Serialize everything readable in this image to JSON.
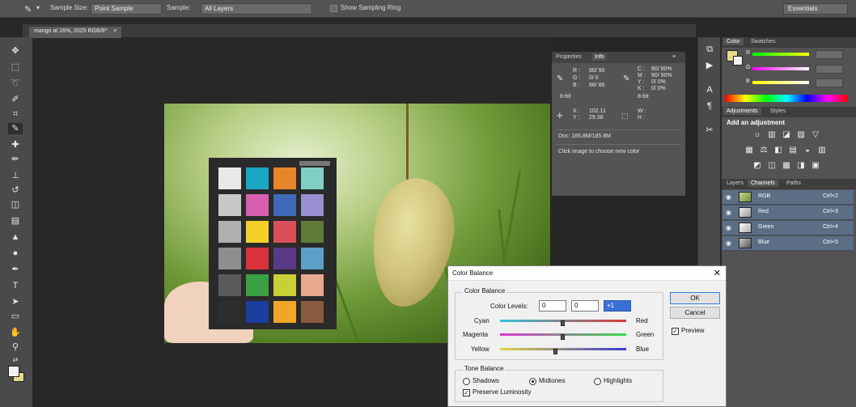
{
  "options_bar": {
    "sample_size_label": "Sample Size:",
    "sample_size_value": "Point Sample",
    "sample_label": "Sample:",
    "sample_value": "All Layers",
    "show_ring_label": "Show Sampling Ring",
    "workspace": "Essentials"
  },
  "document": {
    "tab_title": "mango at 16%, 2025 RGB/8*"
  },
  "info_panel": {
    "tabs": [
      "Properties",
      "Info"
    ],
    "rgb_rows": [
      "R :",
      "G :",
      "B :"
    ],
    "rgb_vals": [
      "90/ 90",
      "0/ 0",
      "86/ 86"
    ],
    "cmyk_rows": [
      "C :",
      "M :",
      "Y :",
      "K :"
    ],
    "cmyk_vals": [
      "80/ 80%",
      "90/ 90%",
      "0/ 0%",
      "0/ 0%"
    ],
    "bit_left": "8-bit",
    "bit_right": "8-bit",
    "xy_rows": [
      "X :",
      "Y :"
    ],
    "xy_vals": [
      "102.11",
      "29.38"
    ],
    "wh_rows": [
      "W :",
      "H :"
    ],
    "doc_size": "Doc: 185.8M/185.8M",
    "hint": "Click image to choose new color"
  },
  "color_panel": {
    "tabs": [
      "Color",
      "Swatches"
    ],
    "channel_labels": [
      "R",
      "G",
      "B"
    ]
  },
  "adjustments_panel": {
    "tabs": [
      "Adjustments",
      "Styles"
    ],
    "heading": "Add an adjustment",
    "icon_rows": [
      [
        "☼",
        "▥",
        "◪",
        "▨",
        "▽"
      ],
      [
        "▦",
        "⚖",
        "◧",
        "▤",
        "◒",
        "▥"
      ],
      [
        "◩",
        "◫",
        "▩",
        "◨",
        "▣"
      ]
    ]
  },
  "channels_panel": {
    "tabs": [
      "Layers",
      "Channels",
      "Paths"
    ],
    "rows": [
      {
        "name": "RGB",
        "shortcut": "Ctrl+2"
      },
      {
        "name": "Red",
        "shortcut": "Ctrl+3"
      },
      {
        "name": "Green",
        "shortcut": "Ctrl+4"
      },
      {
        "name": "Blue",
        "shortcut": "Ctrl+5"
      }
    ]
  },
  "dialog": {
    "title": "Color Balance",
    "close": "✕",
    "color_balance_group": "Color Balance",
    "color_levels_label": "Color Levels:",
    "levels": [
      "0",
      "0",
      "+1"
    ],
    "sliders": [
      {
        "left": "Cyan",
        "right": "Red",
        "fraction": 0.5
      },
      {
        "left": "Magenta",
        "right": "Green",
        "fraction": 0.5
      },
      {
        "left": "Yellow",
        "right": "Blue",
        "fraction": 0.44
      }
    ],
    "tone_balance_group": "Tone Balance",
    "tones": [
      "Shadows",
      "Midtones",
      "Highlights"
    ],
    "selected_tone": "Midtones",
    "preserve_luminosity": "Preserve Luminosity",
    "ok": "OK",
    "cancel": "Cancel",
    "preview": "Preview"
  },
  "colors": {
    "foreground": "#f2f2f2",
    "background": "#e8d98a",
    "checker_patches": [
      "#e8e8e8",
      "#1aa7c4",
      "#e8852a",
      "#7fd0c2",
      "#c8c8c8",
      "#d85fb0",
      "#3f6ab8",
      "#9a8fd0",
      "#b0b0b0",
      "#f2d12a",
      "#d9505a",
      "#5e7c36",
      "#8e8e8e",
      "#d8323a",
      "#5a3a86",
      "#5aa0c8",
      "#5a5a5a",
      "#3aa042",
      "#c9d036",
      "#e8a890",
      "#2e2e2e",
      "#1b3da0",
      "#f2a628",
      "#8a5a3e"
    ]
  }
}
